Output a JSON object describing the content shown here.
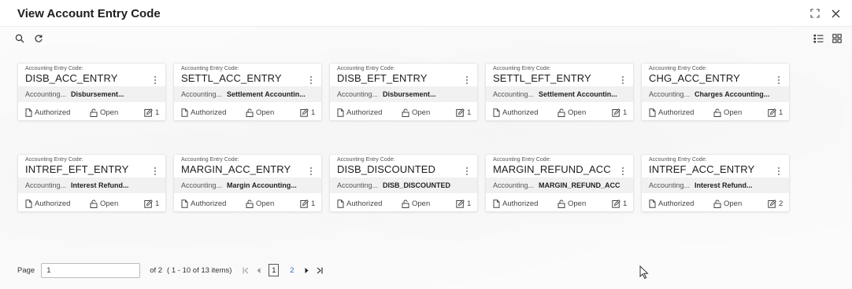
{
  "window": {
    "title": "View Account Entry Code"
  },
  "cards": [
    {
      "label": "Accounting Entry Code:",
      "code": "DISB_ACC_ENTRY",
      "type": "Accounting...",
      "desc": "Disbursement...",
      "status": "Authorized",
      "record": "Open",
      "mod": "1"
    },
    {
      "label": "Accounting Entry Code:",
      "code": "SETTL_ACC_ENTRY",
      "type": "Accounting...",
      "desc": "Settlement Accountin...",
      "status": "Authorized",
      "record": "Open",
      "mod": "1"
    },
    {
      "label": "Accounting Entry Code:",
      "code": "DISB_EFT_ENTRY",
      "type": "Accounting...",
      "desc": "Disbursement...",
      "status": "Authorized",
      "record": "Open",
      "mod": "1"
    },
    {
      "label": "Accounting Entry Code:",
      "code": "SETTL_EFT_ENTRY",
      "type": "Accounting...",
      "desc": "Settlement Accountin...",
      "status": "Authorized",
      "record": "Open",
      "mod": "1"
    },
    {
      "label": "Accounting Entry Code:",
      "code": "CHG_ACC_ENTRY",
      "type": "Accounting...",
      "desc": "Charges Accounting...",
      "status": "Authorized",
      "record": "Open",
      "mod": "1"
    },
    {
      "label": "Accounting Entry Code:",
      "code": "INTREF_EFT_ENTRY",
      "type": "Accounting...",
      "desc": "Interest Refund...",
      "status": "Authorized",
      "record": "Open",
      "mod": "1"
    },
    {
      "label": "Accounting Entry Code:",
      "code": "MARGIN_ACC_ENTRY",
      "type": "Accounting...",
      "desc": "Margin Accounting...",
      "status": "Authorized",
      "record": "Open",
      "mod": "1"
    },
    {
      "label": "Accounting Entry Code:",
      "code": "DISB_DISCOUNTED",
      "type": "Accounting...",
      "desc": "DISB_DISCOUNTED",
      "status": "Authorized",
      "record": "Open",
      "mod": "1"
    },
    {
      "label": "Accounting Entry Code:",
      "code": "MARGIN_REFUND_ACC",
      "type": "Accounting...",
      "desc": "MARGIN_REFUND_ACC",
      "status": "Authorized",
      "record": "Open",
      "mod": "1"
    },
    {
      "label": "Accounting Entry Code:",
      "code": "INTREF_ACC_ENTRY",
      "type": "Accounting...",
      "desc": "Interest Refund...",
      "status": "Authorized",
      "record": "Open",
      "mod": "2"
    }
  ],
  "pagination": {
    "page_label": "Page",
    "page_value": "1",
    "of_text": "of 2",
    "items_text": "( 1 - 10 of 13 items)",
    "pages": [
      "1",
      "2"
    ],
    "current_page": "1"
  },
  "colors": {
    "accent": "#2a6cd6",
    "card_desc_bg": "#f1f1f1"
  },
  "icons": {
    "header": [
      "expand-icon",
      "close-icon"
    ],
    "toolbar_left": [
      "search-icon",
      "refresh-icon"
    ],
    "toolbar_right": [
      "list-view-icon",
      "grid-view-icon"
    ]
  }
}
